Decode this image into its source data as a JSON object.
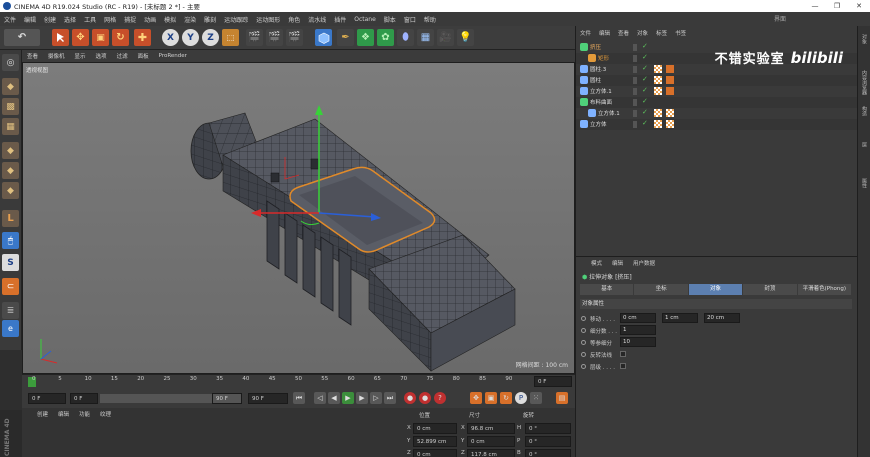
{
  "window": {
    "title": "CINEMA 4D R19.024 Studio (RC - R19) - [未标题 2 *] - 主要",
    "controls": [
      "—",
      "❐",
      "✕"
    ]
  },
  "menubar": {
    "items": [
      "文件",
      "编辑",
      "创建",
      "选择",
      "工具",
      "网格",
      "捕捉",
      "动画",
      "模拟",
      "渲染",
      "雕刻",
      "运动跟踪",
      "运动图形",
      "角色",
      "流水线",
      "插件",
      "Octane",
      "脚本",
      "窗口",
      "帮助"
    ],
    "layout_label": "界面"
  },
  "toolbar": {
    "axis_buttons": [
      "X",
      "Y",
      "Z"
    ]
  },
  "viewport": {
    "menu": [
      "查看",
      "摄像机",
      "显示",
      "选项",
      "过滤",
      "面板",
      "ProRender"
    ],
    "label": "透视视图",
    "grid_spacing": "网格间距 : 100 cm"
  },
  "timeline": {
    "ticks": [
      "0",
      "5",
      "10",
      "15",
      "20",
      "25",
      "30",
      "35",
      "40",
      "45",
      "50",
      "55",
      "60",
      "65",
      "70",
      "75",
      "80",
      "85",
      "90"
    ],
    "current_frame": "0 F"
  },
  "playback": {
    "start": "0 F",
    "start2": "0 F",
    "end_small": "90 F",
    "end": "90 F"
  },
  "material_menu": [
    "创建",
    "编辑",
    "功能",
    "纹理"
  ],
  "coordinates": {
    "headers": [
      "位置",
      "尺寸",
      "旋转"
    ],
    "rows": [
      {
        "axis": "X",
        "pos": "0 cm",
        "size_axis": "X",
        "size": "96.8 cm",
        "rot_axis": "H",
        "rot": "0 °"
      },
      {
        "axis": "Y",
        "pos": "52.899 cm",
        "size_axis": "Y",
        "size": "0 cm",
        "rot_axis": "P",
        "rot": "0 °"
      },
      {
        "axis": "Z",
        "pos": "0 cm",
        "size_axis": "Z",
        "size": "117.8 cm",
        "rot_axis": "B",
        "rot": "0 °"
      }
    ]
  },
  "brand": "CINEMA 4D",
  "object_manager": {
    "menu": [
      "文件",
      "编辑",
      "查看",
      "对象",
      "标签",
      "书签"
    ],
    "objects": [
      {
        "name": "挤压",
        "indent": 0,
        "color": "#4fd17a"
      },
      {
        "name": "矩形",
        "indent": 1,
        "color": "#e29a3a"
      },
      {
        "name": "圆柱.3",
        "indent": 0,
        "color": "#7fb2ff"
      },
      {
        "name": "圆柱",
        "indent": 0,
        "color": "#7fb2ff"
      },
      {
        "name": "立方体.1",
        "indent": 0,
        "color": "#7fb2ff"
      },
      {
        "name": "布料曲面",
        "indent": 0,
        "color": "#4fd17a"
      },
      {
        "name": "立方体.1",
        "indent": 1,
        "color": "#7fb2ff"
      },
      {
        "name": "立方体",
        "indent": 0,
        "color": "#7fb2ff"
      }
    ]
  },
  "watermark": {
    "text": "不错实验室",
    "logo": "bilibili"
  },
  "attribute_manager": {
    "menu": [
      "模式",
      "编辑",
      "用户数据"
    ],
    "title": "拉伸对象 [挤压]",
    "tabs": [
      "基本",
      "坐标",
      "对象",
      "封顶",
      "平滑着色(Phong)"
    ],
    "active_tab": "对象",
    "section": "对象属性",
    "fields": [
      {
        "label": "移动 . . . .",
        "values": [
          "0 cm",
          "1 cm",
          "20 cm"
        ]
      },
      {
        "label": "细分数 . . .",
        "values": [
          "1"
        ]
      },
      {
        "label": "等参细分",
        "values": [
          "10"
        ]
      },
      {
        "label": "反转法线",
        "values": []
      },
      {
        "label": "层级 . . . .",
        "values": []
      }
    ]
  },
  "right_strip": [
    "对象",
    "内容浏览器",
    "构造",
    "层",
    "属性"
  ]
}
